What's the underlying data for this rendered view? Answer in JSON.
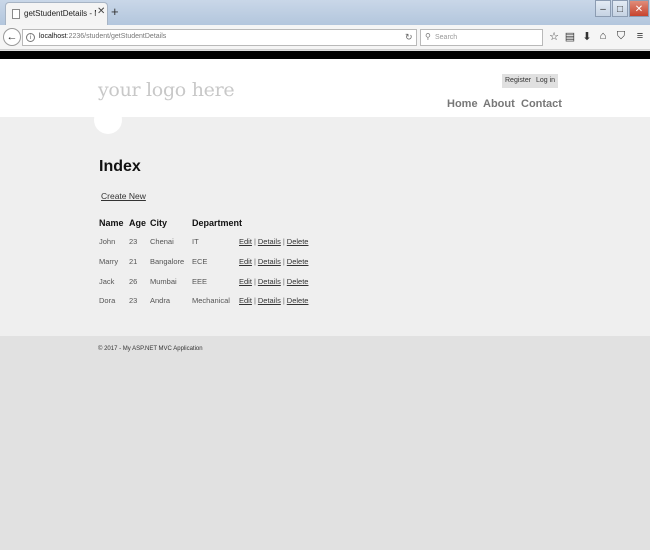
{
  "browser": {
    "tab_title": "getStudentDetails - My ASP.N",
    "url_host": "localhost",
    "url_rest": ":2236/student/getStudentDetails",
    "search_placeholder": "Search"
  },
  "header": {
    "logo": "your logo here",
    "register": "Register",
    "login": "Log in",
    "menu": [
      "Home",
      "About",
      "Contact"
    ]
  },
  "main": {
    "title": "Index",
    "create_link": "Create New",
    "columns": [
      "Name",
      "Age",
      "City",
      "Department"
    ],
    "rows": [
      {
        "name": "John",
        "age": "23",
        "city": "Chenai",
        "department": "IT"
      },
      {
        "name": "Marry",
        "age": "21",
        "city": "Bangalore",
        "department": "ECE"
      },
      {
        "name": "Jack",
        "age": "26",
        "city": "Mumbai",
        "department": "EEE"
      },
      {
        "name": "Dora",
        "age": "23",
        "city": "Andra",
        "department": "Mechanical"
      }
    ],
    "actions": {
      "edit": "Edit",
      "details": "Details",
      "delete": "Delete",
      "separator": "|"
    }
  },
  "footer": {
    "text": "© 2017 - My ASP.NET MVC Application"
  }
}
